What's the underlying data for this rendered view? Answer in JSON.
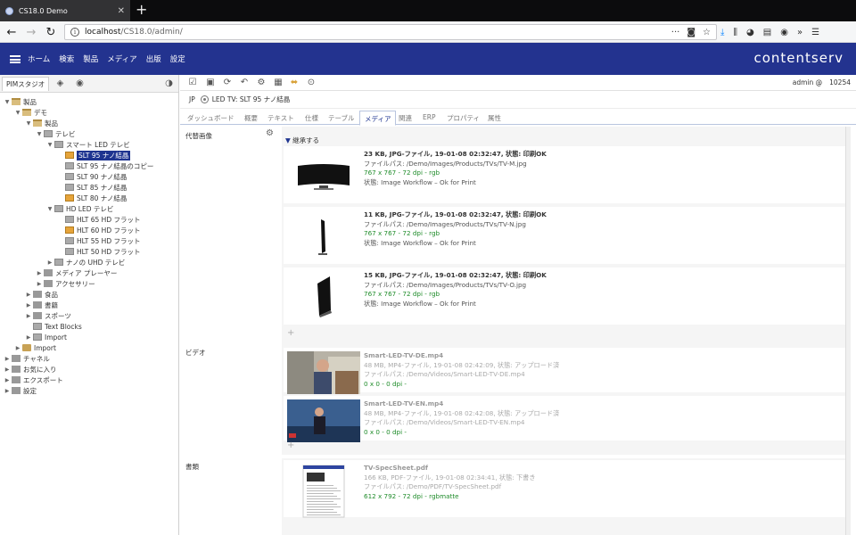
{
  "browser": {
    "tab_title": "CS18.0 Demo",
    "url_host": "localhost",
    "url_path": "/CS18.0/admin/"
  },
  "app": {
    "menu": [
      "ホーム",
      "検索",
      "製品",
      "メディア",
      "出版",
      "設定"
    ],
    "brand": "contentserv",
    "user": "admin @",
    "id": "10254"
  },
  "left": {
    "tab_label": "PIMスタジオ",
    "tree": [
      {
        "label": "製品",
        "level": 0,
        "icon": "folder-open",
        "exp": "▼"
      },
      {
        "label": "デモ",
        "level": 1,
        "icon": "folder-open",
        "exp": "▼"
      },
      {
        "label": "製品",
        "level": 2,
        "icon": "folder-open",
        "exp": "▼"
      },
      {
        "label": "テレビ",
        "level": 3,
        "icon": "item",
        "exp": "▼"
      },
      {
        "label": "スマート LED テレビ",
        "level": 4,
        "icon": "item",
        "exp": "▼"
      },
      {
        "label": "SLT 95 ナノ結晶",
        "level": 5,
        "icon": "itemw",
        "exp": "",
        "selected": true
      },
      {
        "label": "SLT 95 ナノ結晶のコピー",
        "level": 5,
        "icon": "item",
        "exp": ""
      },
      {
        "label": "SLT 90 ナノ結晶",
        "level": 5,
        "icon": "item",
        "exp": ""
      },
      {
        "label": "SLT 85 ナノ結晶",
        "level": 5,
        "icon": "item",
        "exp": ""
      },
      {
        "label": "SLT 80 ナノ結晶",
        "level": 5,
        "icon": "itemw",
        "exp": ""
      },
      {
        "label": "HD LED テレビ",
        "level": 4,
        "icon": "item",
        "exp": "▼"
      },
      {
        "label": "HLT 65 HD フラット",
        "level": 5,
        "icon": "item",
        "exp": ""
      },
      {
        "label": "HLT 60 HD フラット",
        "level": 5,
        "icon": "itemw",
        "exp": ""
      },
      {
        "label": "HLT 55 HD フラット",
        "level": 5,
        "icon": "item",
        "exp": ""
      },
      {
        "label": "HLT 50 HD フラット",
        "level": 5,
        "icon": "item",
        "exp": ""
      },
      {
        "label": "ナノの UHD テレビ",
        "level": 4,
        "icon": "item",
        "exp": "▶"
      },
      {
        "label": "メディア プレーヤー",
        "level": 3,
        "icon": "grey",
        "exp": "▶"
      },
      {
        "label": "アクセサリー",
        "level": 3,
        "icon": "grey",
        "exp": "▶"
      },
      {
        "label": "食品",
        "level": 2,
        "icon": "grey",
        "exp": "▶"
      },
      {
        "label": "書籍",
        "level": 2,
        "icon": "grey",
        "exp": "▶"
      },
      {
        "label": "スポーツ",
        "level": 2,
        "icon": "grey",
        "exp": "▶"
      },
      {
        "label": "Text Blocks",
        "level": 2,
        "icon": "item",
        "exp": ""
      },
      {
        "label": "Import",
        "level": 2,
        "icon": "item",
        "exp": "▶"
      },
      {
        "label": "Import",
        "level": 1,
        "icon": "folder",
        "exp": "▶"
      },
      {
        "label": "チャネル",
        "level": 0,
        "icon": "grey",
        "exp": "▶"
      },
      {
        "label": "お気に入り",
        "level": 0,
        "icon": "grey",
        "exp": "▶"
      },
      {
        "label": "エクスポート",
        "level": 0,
        "icon": "grey",
        "exp": "▶"
      },
      {
        "label": "設定",
        "level": 0,
        "icon": "grey",
        "exp": "▶"
      }
    ]
  },
  "main": {
    "lang": "JP",
    "title": "LED TV: SLT 95 ナノ結晶",
    "tabs": [
      "ダッシュボード",
      "概要",
      "テキスト",
      "仕様",
      "テーブル",
      "メディア",
      "関連",
      "ERP",
      "プロパティ",
      "属性"
    ],
    "active_tab": "メディア",
    "sections": {
      "images_label": "代替画像",
      "inherit_label": "継承する",
      "video_label": "ビデオ",
      "docs_label": "書類"
    },
    "images": [
      {
        "l1": "23 KB, JPG-ファイル, 19-01-08 02:32:47, 状態: 印刷OK",
        "l2": "ファイルパス: /Demo/Images/Products/TVs/TV-M.jpg",
        "l3": "767 x 767 - 72 dpi - rgb",
        "l4": "状態: Image Workflow – Ok for Print"
      },
      {
        "l1": "11 KB, JPG-ファイル, 19-01-08 02:32:47, 状態: 印刷OK",
        "l2": "ファイルパス: /Demo/Images/Products/TVs/TV-N.jpg",
        "l3": "767 x 767 - 72 dpi - rgb",
        "l4": "状態: Image Workflow – Ok for Print"
      },
      {
        "l1": "15 KB, JPG-ファイル, 19-01-08 02:32:47, 状態: 印刷OK",
        "l2": "ファイルパス: /Demo/Images/Products/TVs/TV-O.jpg",
        "l3": "767 x 767 - 72 dpi - rgb",
        "l4": "状態: Image Workflow – Ok for Print"
      }
    ],
    "videos": [
      {
        "l1": "Smart-LED-TV-DE.mp4",
        "l2": "48 MB, MP4-ファイル, 19-01-08 02:42:09, 状態: アップロード済",
        "l3": "ファイルパス: /Demo/Videos/Smart-LED-TV-DE.mp4",
        "l4": "0 x 0 - 0 dpi -"
      },
      {
        "l1": "Smart-LED-TV-EN.mp4",
        "l2": "48 MB, MP4-ファイル, 19-01-08 02:42:08, 状態: アップロード済",
        "l3": "ファイルパス: /Demo/Videos/Smart-LED-TV-EN.mp4",
        "l4": "0 x 0 - 0 dpi -"
      }
    ],
    "docs": [
      {
        "l1": "TV-SpecSheet.pdf",
        "l2": "166 KB, PDF-ファイル, 19-01-08 02:34:41, 状態: 下書き",
        "l3": "ファイルパス: /Demo/PDF/TV-SpecSheet.pdf",
        "l4": "612 x 792 - 72 dpi - rgbmatte"
      }
    ]
  }
}
